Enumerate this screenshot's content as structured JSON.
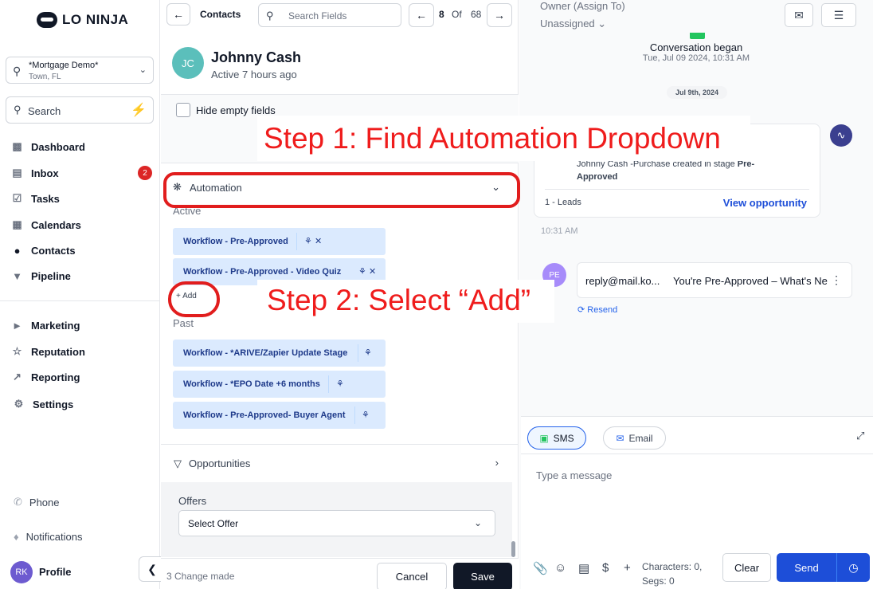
{
  "sidebar": {
    "logo_text": "LO NINJA",
    "location": {
      "name": "*Mortgage Demo*",
      "sub": "Town, FL"
    },
    "search_label": "Search",
    "nav": [
      {
        "label": "Dashboard",
        "icon": "dashboard-icon"
      },
      {
        "label": "Inbox",
        "icon": "inbox-icon",
        "badge": "2"
      },
      {
        "label": "Tasks",
        "icon": "tasks-icon"
      },
      {
        "label": "Calendars",
        "icon": "calendar-icon"
      },
      {
        "label": "Contacts",
        "icon": "contacts-icon"
      },
      {
        "label": "Pipeline",
        "icon": "pipeline-icon"
      }
    ],
    "nav2": [
      {
        "label": "Marketing",
        "icon": "megaphone-icon"
      },
      {
        "label": "Reputation",
        "icon": "star-icon"
      },
      {
        "label": "Reporting",
        "icon": "chart-icon"
      },
      {
        "label": "Settings",
        "icon": "gear-icon"
      }
    ],
    "bottom": {
      "phone": "Phone",
      "notifications": "Notifications",
      "profile": "Profile",
      "avatar_initials": "RK"
    }
  },
  "contact_panel": {
    "title": "Contacts",
    "search_placeholder": "Search Fields",
    "page_current": "8",
    "page_of": "Of",
    "page_total": "68",
    "contact": {
      "initials": "JC",
      "name": "Johnny Cash",
      "status": "Active 7 hours ago"
    },
    "hide_empty_label": "Hide empty fields",
    "automation_label": "Automation",
    "active_label": "Active",
    "active_workflows": [
      "Workflow - Pre-Approved",
      "Workflow - Pre-Approved - Video Quiz"
    ],
    "add_label": "Add",
    "past_label": "Past",
    "past_workflows": [
      "Workflow - *ARIVE/Zapier Update Stage",
      "Workflow - *EPO Date +6 months",
      "Workflow - Pre-Approved- Buyer Agent"
    ],
    "opportunities_label": "Opportunities",
    "offers_label": "Offers",
    "offer_select": "Select Offer",
    "changes_text": "3 Change made",
    "cancel_label": "Cancel",
    "save_label": "Save"
  },
  "conversation": {
    "owner_label": "Owner (Assign To)",
    "owner_value": "Unassigned",
    "began": "Conversation began",
    "began_date": "Tue, Jul 09 2024, 10:31 AM",
    "date_pill": "Jul 9th, 2024",
    "opp_desc_a": "Johnny Cash -Purchase created in stage ",
    "opp_desc_b": "Pre-Approved",
    "opp_leads": "1 - Leads",
    "opp_view": "View opportunity",
    "time": "10:31 AM",
    "msg_avatar": "PE",
    "msg_from": "reply@mail.ko...",
    "msg_subject": "You're Pre-Approved – What's Ne",
    "resend": "Resend",
    "tab_sms": "SMS",
    "tab_email": "Email",
    "type_placeholder": "Type a message",
    "chars": "Characters: 0,",
    "segs": "Segs: 0",
    "clear_label": "Clear",
    "send_label": "Send"
  },
  "annotations": {
    "step1": "Step 1: Find Automation Dropdown",
    "step2": "Step 2: Select “Add”"
  },
  "colors": {
    "accent": "#1d4ed8",
    "annotation": "#ef1c1c",
    "workflow_pill": "#dbeafe"
  }
}
